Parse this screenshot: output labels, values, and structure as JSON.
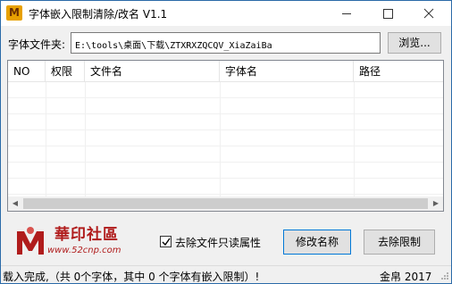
{
  "window": {
    "title": "字体嵌入限制清除/改名 V1.1",
    "icon": "app-logo-icon"
  },
  "folder": {
    "label": "字体文件夹:",
    "value": "E:\\tools\\桌面\\下载\\ZTXRXZQCQV_XiaZaiBa",
    "browse_label": "浏览..."
  },
  "table": {
    "columns": [
      "NO",
      "权限",
      "文件名",
      "字体名",
      "路径"
    ],
    "rows": []
  },
  "logo": {
    "name": "華印社區",
    "url": "www.52cnp.com"
  },
  "options": {
    "remove_readonly_label": "去除文件只读属性",
    "remove_readonly_checked": true
  },
  "buttons": {
    "rename_label": "修改名称",
    "clear_label": "去除限制"
  },
  "status": {
    "message": "载入完成,（共 0个字体，其中 0 个字体有嵌入限制）!",
    "copyright": "金帛 2017"
  },
  "colors": {
    "window_border": "#2b6aa8",
    "logo_red": "#b01c1c",
    "focus_blue": "#0078d7"
  }
}
